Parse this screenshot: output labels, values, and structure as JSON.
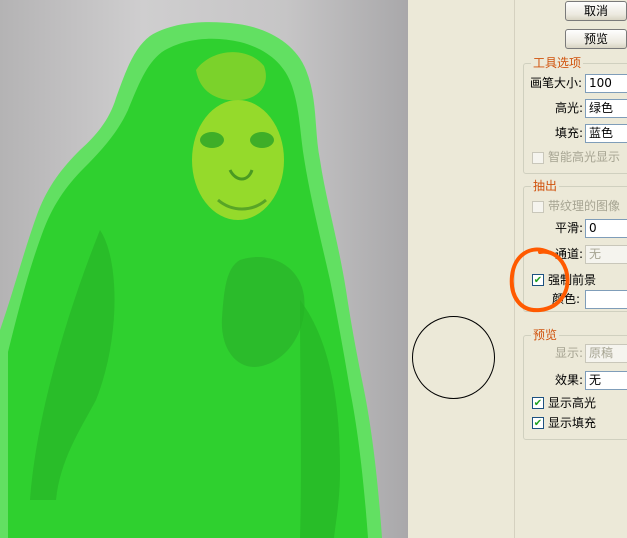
{
  "buttons": {
    "cancel": "取消",
    "preview": "预览"
  },
  "tool_options": {
    "title": "工具选项",
    "brush_size_label": "画笔大小:",
    "brush_size_value": "100",
    "highlight_label": "高光:",
    "highlight_value": "绿色",
    "fill_label": "填充:",
    "fill_value": "蓝色",
    "smart_highlight_label": "智能高光显示"
  },
  "extract": {
    "title": "抽出",
    "textured_image_label": "带纹理的图像",
    "smooth_label": "平滑:",
    "smooth_value": "0",
    "channel_label": "通道:",
    "channel_value": "无",
    "force_foreground_label": "强制前景",
    "color_label": "颜色:"
  },
  "preview": {
    "title": "预览",
    "show_label": "显示:",
    "show_value": "原稿",
    "effect_label": "效果:",
    "effect_value": "无",
    "show_highlight_label": "显示高光",
    "show_fill_label": "显示填充"
  },
  "checkboxes": {
    "smart_highlight": false,
    "textured_image": false,
    "force_foreground": true,
    "show_highlight": true,
    "show_fill": true
  },
  "colors": {
    "highlight_green": "#2fd02f",
    "annotation_orange": "#ff5a00",
    "group_title": "#d0520c"
  }
}
